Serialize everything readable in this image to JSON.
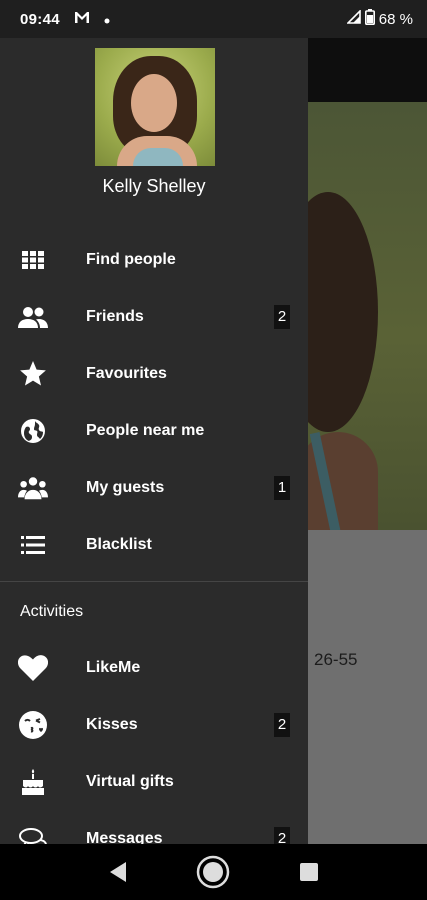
{
  "status_bar": {
    "time": "09:44",
    "battery": "68 %",
    "icons": [
      "gmail-icon",
      "dot-icon",
      "signal-icon",
      "battery-icon"
    ]
  },
  "drawer": {
    "profile_name": "Kelly Shelley",
    "items": [
      {
        "label": "Find people",
        "icon": "grid-icon",
        "badge": ""
      },
      {
        "label": "Friends",
        "icon": "friends-icon",
        "badge": "2"
      },
      {
        "label": "Favourites",
        "icon": "star-icon",
        "badge": ""
      },
      {
        "label": "People near me",
        "icon": "globe-icon",
        "badge": ""
      },
      {
        "label": "My guests",
        "icon": "guests-icon",
        "badge": "1"
      },
      {
        "label": "Blacklist",
        "icon": "list-icon",
        "badge": ""
      }
    ],
    "section_title": "Activities",
    "activities": [
      {
        "label": "LikeMe",
        "icon": "heart-icon",
        "badge": ""
      },
      {
        "label": "Kisses",
        "icon": "kiss-icon",
        "badge": "2"
      },
      {
        "label": "Virtual gifts",
        "icon": "cake-icon",
        "badge": ""
      },
      {
        "label": "Messages",
        "icon": "chat-icon",
        "badge": "2"
      }
    ]
  },
  "background": {
    "age_range": "26-55"
  },
  "colors": {
    "drawer_bg": "#2b2b2b",
    "status_bar_bg": "#1f1f1f",
    "badge_bg": "#111111"
  }
}
